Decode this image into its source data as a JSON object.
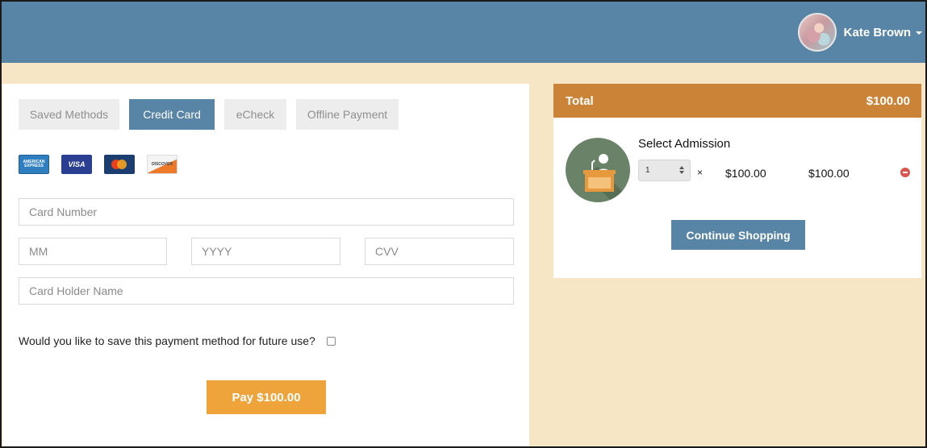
{
  "header": {
    "user_name": "Kate Brown",
    "avatar_icon": "user-avatar",
    "colors": {
      "header_bg": "#5884a5",
      "page_bg": "#f6e6c6"
    }
  },
  "payment": {
    "tabs": [
      {
        "label": "Saved Methods",
        "active": false
      },
      {
        "label": "Credit Card",
        "active": true
      },
      {
        "label": "eCheck",
        "active": false
      },
      {
        "label": "Offline Payment",
        "active": false
      }
    ],
    "card_brands": [
      {
        "name": "amex-icon",
        "text": "AMERICAN EXPRESS"
      },
      {
        "name": "visa-icon",
        "text": "VISA"
      },
      {
        "name": "mastercard-icon",
        "text": "MasterCard"
      },
      {
        "name": "discover-icon",
        "text": "DISCOVER"
      }
    ],
    "fields": {
      "card_number": {
        "placeholder": "Card Number",
        "value": ""
      },
      "month": {
        "placeholder": "MM",
        "value": ""
      },
      "year": {
        "placeholder": "YYYY",
        "value": ""
      },
      "cvv": {
        "placeholder": "CVV",
        "value": ""
      },
      "holder_name": {
        "placeholder": "Card Holder Name",
        "value": ""
      }
    },
    "save_question": "Would you like to save this payment method for future use?",
    "save_checked": false,
    "pay_label": "Pay $100.00",
    "colors": {
      "pay_button": "#eea43a",
      "active_tab": "#5884a5"
    }
  },
  "cart": {
    "total_label": "Total",
    "total_value": "$100.00",
    "item": {
      "icon": "speaker-podium-icon",
      "title": "Select Admission",
      "quantity": "1",
      "times": "×",
      "price": "$100.00",
      "line_total": "$100.00"
    },
    "continue_label": "Continue Shopping",
    "colors": {
      "total_bar": "#cb8437",
      "remove_icon": "#d9534f"
    }
  }
}
